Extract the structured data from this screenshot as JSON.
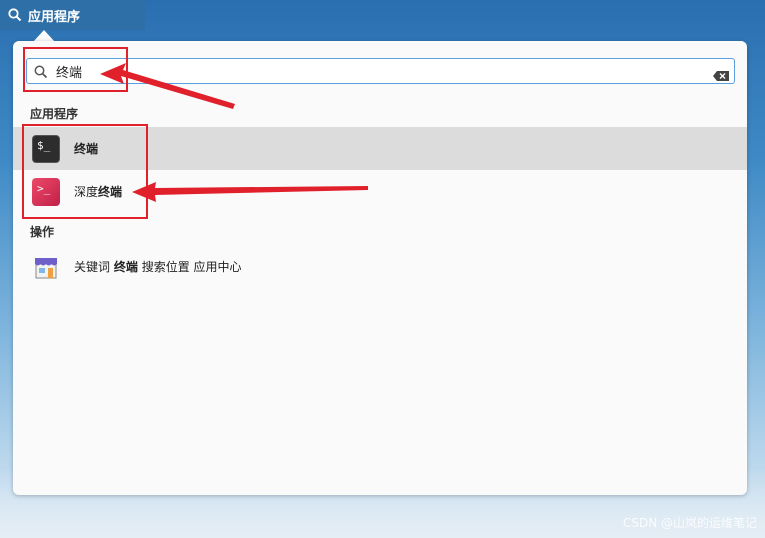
{
  "topbar": {
    "label": "应用程序"
  },
  "search": {
    "value": "终端",
    "placeholder": ""
  },
  "sections": {
    "apps_title": "应用程序",
    "actions_title": "操作"
  },
  "apps": [
    {
      "label": "终端",
      "icon": "terminal-icon",
      "selected": true
    },
    {
      "label_prefix": "深度",
      "label_match": "终端",
      "icon": "deepin-terminal-icon",
      "selected": false
    }
  ],
  "action": {
    "prefix": "关键词",
    "keyword": "终端",
    "suffix": "搜索位置 应用中心",
    "icon": "app-store-icon"
  },
  "icons": {
    "terminal_glyph": "$_",
    "deepin_glyph": ">_"
  },
  "colors": {
    "annotation": "#e0202a",
    "selection": "#dcdcdc",
    "focus_border": "#5aa0e0"
  },
  "watermark": "CSDN @山岚的运维笔记"
}
